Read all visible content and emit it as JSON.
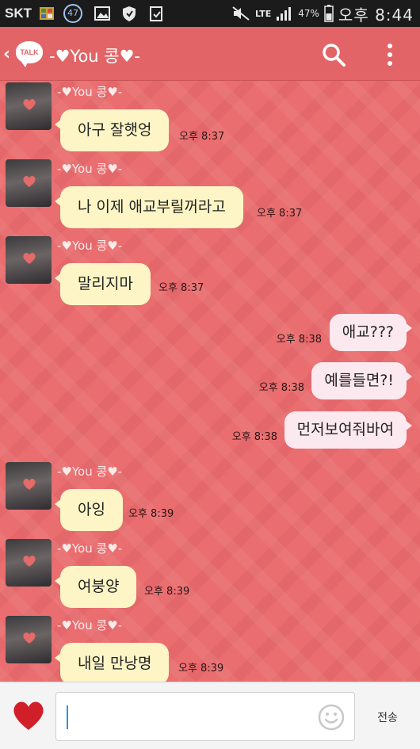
{
  "status_bar": {
    "carrier": "SKT",
    "badge": "47",
    "network": "LTE",
    "battery": "47%",
    "time": "오후 8:44"
  },
  "header": {
    "logo_text": "TALK",
    "title": "-♥You 콩♥-"
  },
  "messages": [
    {
      "direction": "in",
      "sender": "-♥You 콩♥-",
      "text": "아구 잘햇엉",
      "time": "오후 8:37"
    },
    {
      "direction": "in",
      "sender": "-♥You 콩♥-",
      "text": "나 이제 애교부릴꺼라고",
      "time": "오후 8:37"
    },
    {
      "direction": "in",
      "sender": "-♥You 콩♥-",
      "text": "말리지마",
      "time": "오후 8:37"
    },
    {
      "direction": "out",
      "text": "애교???",
      "time": "오후 8:38"
    },
    {
      "direction": "out",
      "text": "예를들면?!",
      "time": "오후 8:38"
    },
    {
      "direction": "out",
      "text": "먼저보여줘바여",
      "time": "오후 8:38"
    },
    {
      "direction": "in",
      "sender": "-♥You 콩♥-",
      "text": "아잉",
      "time": "오후 8:39"
    },
    {
      "direction": "in",
      "sender": "-♥You 콩♥-",
      "text": "여붕양",
      "time": "오후 8:39"
    },
    {
      "direction": "in",
      "sender": "-♥You 콩♥-",
      "text": "내일 만낭명",
      "time": "오후 8:39"
    }
  ],
  "input_bar": {
    "value": "",
    "send_label": "전송"
  },
  "colors": {
    "chat_background": "#ea6d6f",
    "incoming_bubble": "#fdf5c6",
    "outgoing_bubble": "#fce9f0",
    "header": "#e26466"
  }
}
